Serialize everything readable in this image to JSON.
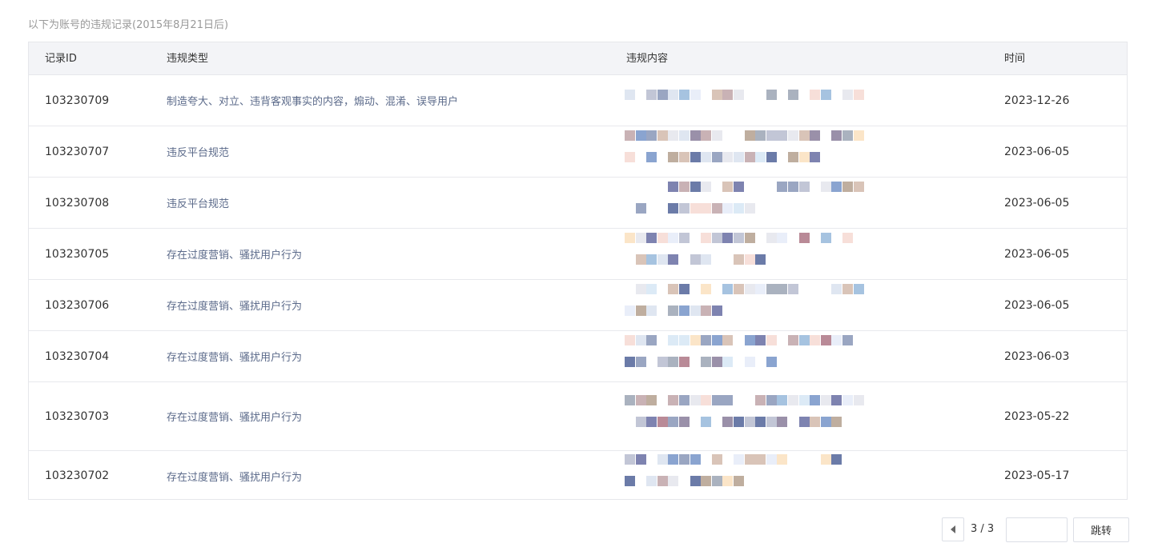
{
  "note": "以下为账号的违规记录(2015年8月21日后)",
  "table": {
    "headers": [
      "记录ID",
      "违规类型",
      "违规内容",
      "时间"
    ],
    "rows": [
      {
        "id": "103230709",
        "type": "制造夸大、对立、违背客观事实的内容，煽动、混淆、误导用户",
        "time": "2023-12-26"
      },
      {
        "id": "103230707",
        "type": "违反平台规范",
        "time": "2023-06-05"
      },
      {
        "id": "103230708",
        "type": "违反平台规范",
        "time": "2023-06-05"
      },
      {
        "id": "103230705",
        "type": "存在过度营销、骚扰用户行为",
        "time": "2023-06-05"
      },
      {
        "id": "103230706",
        "type": "存在过度营销、骚扰用户行为",
        "time": "2023-06-05"
      },
      {
        "id": "103230704",
        "type": "存在过度营销、骚扰用户行为",
        "time": "2023-06-03"
      },
      {
        "id": "103230703",
        "type": "存在过度营销、骚扰用户行为",
        "time": "2023-05-22"
      },
      {
        "id": "103230702",
        "type": "存在过度营销、骚扰用户行为",
        "time": "2023-05-17"
      }
    ]
  },
  "pagination": {
    "page_text": "3 / 3",
    "input_value": "",
    "go_label": "跳转"
  },
  "colors": {
    "header_bg": "#f3f4f7",
    "border": "#e6e7eb",
    "type_text": "#5b6a8a"
  },
  "icons": {
    "prev": "caret-left-icon"
  }
}
